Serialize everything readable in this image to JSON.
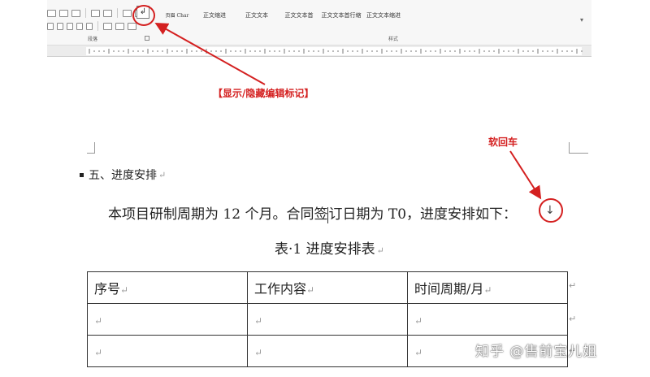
{
  "ribbon": {
    "styles": [
      "页眉 Char",
      "正文缩进",
      "正文文本",
      "正文文本首",
      "正文文本首行缩",
      "正文文本缩进"
    ],
    "group_paragraph": "段落",
    "group_styles": "样式",
    "marks_button_glyph": "↲"
  },
  "annotations": {
    "marks_label": "【显示/隐藏编辑标记】",
    "soft_return_label": "软回车",
    "color": "#d42020"
  },
  "document": {
    "heading": "五、进度安排",
    "paragraph_before_cursor": "本项目研制周期为 12 个月。合同签",
    "paragraph_after_cursor": "订日期为 T0，进度安排如下：",
    "soft_return_glyph": "↓",
    "paragraph_mark": "↵",
    "caption": "表·1 进度安排表",
    "table": {
      "headers": [
        "序号",
        "工作内容",
        "时间周期/月"
      ],
      "rows": [
        [
          "",
          "",
          ""
        ],
        [
          "",
          "",
          ""
        ]
      ]
    }
  },
  "watermark": "知乎 @售前宝儿姐"
}
